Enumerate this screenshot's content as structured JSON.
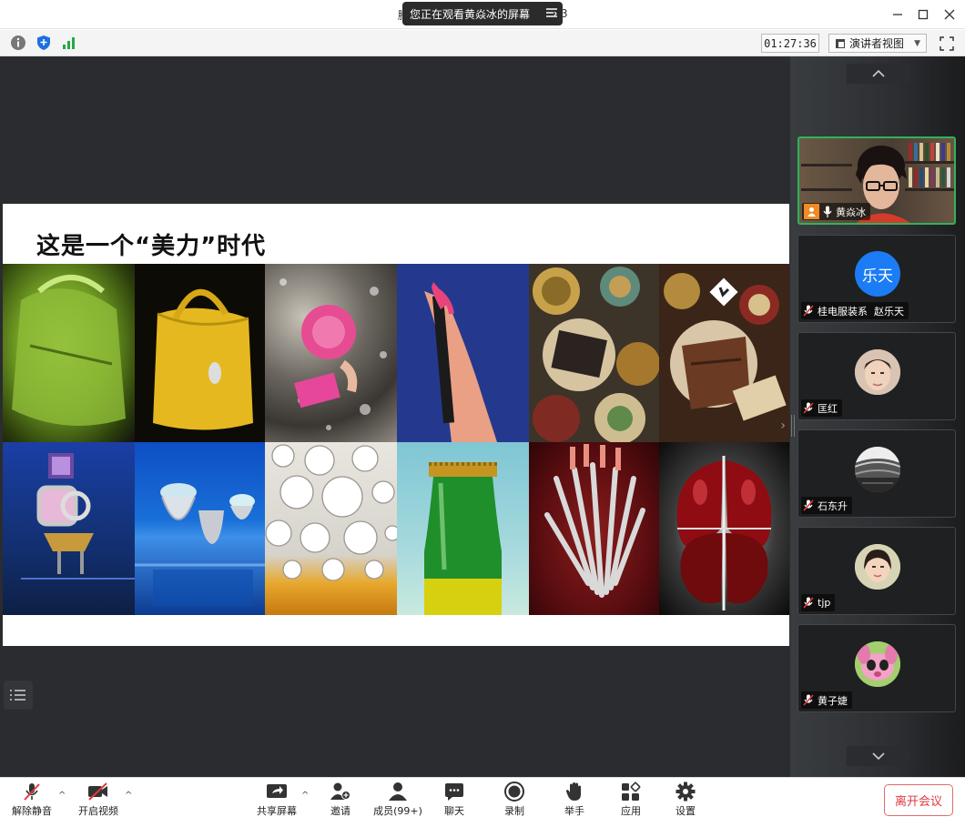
{
  "window": {
    "share_banner": "您正在观看黄焱冰的屏幕",
    "title_left_fragment": "腾",
    "title_right_fragment": "3",
    "controls": [
      "minimize-icon",
      "maximize-icon",
      "close-icon"
    ]
  },
  "infobar": {
    "timer": "01:27:36",
    "view_mode": "演讲者视图",
    "icons": [
      "info-icon",
      "shield-icon",
      "signal-icon",
      "fullscreen-icon"
    ]
  },
  "slide": {
    "title": "这是一个“美力”时代",
    "images": [
      "green-handbag",
      "yellow-handbag",
      "pink-compact-gems",
      "lipstick-hand",
      "patterned-plates",
      "leather-wallet-plates",
      "gem-ring-tower",
      "glass-rings-blue",
      "bubbles",
      "green-bottle",
      "wrench-bundle",
      "red-chrome-sculpture"
    ]
  },
  "participants": [
    {
      "name": "黄焱冰",
      "type": "video",
      "active": true,
      "muted": false
    },
    {
      "name": "桂电服装系  赵乐天",
      "type": "letter",
      "letter": "乐天",
      "muted": true
    },
    {
      "name": "匡红",
      "type": "photo",
      "muted": true
    },
    {
      "name": "石东升",
      "type": "photo",
      "muted": true
    },
    {
      "name": "tjp",
      "type": "photo",
      "muted": true
    },
    {
      "name": "黄子婕",
      "type": "photo",
      "muted": true
    }
  ],
  "toolbar": {
    "unmute": "解除静音",
    "start_video": "开启视频",
    "share": "共享屏幕",
    "invite": "邀请",
    "members": "成员(99+)",
    "chat": "聊天",
    "record": "录制",
    "raise_hand": "举手",
    "apps": "应用",
    "settings": "设置",
    "leave": "离开会议"
  },
  "colors": {
    "active_border": "#2fb35a",
    "leave_text": "#e0393e",
    "letter_avatar": "#1b7cf5",
    "mute_red": "#e0393e"
  }
}
